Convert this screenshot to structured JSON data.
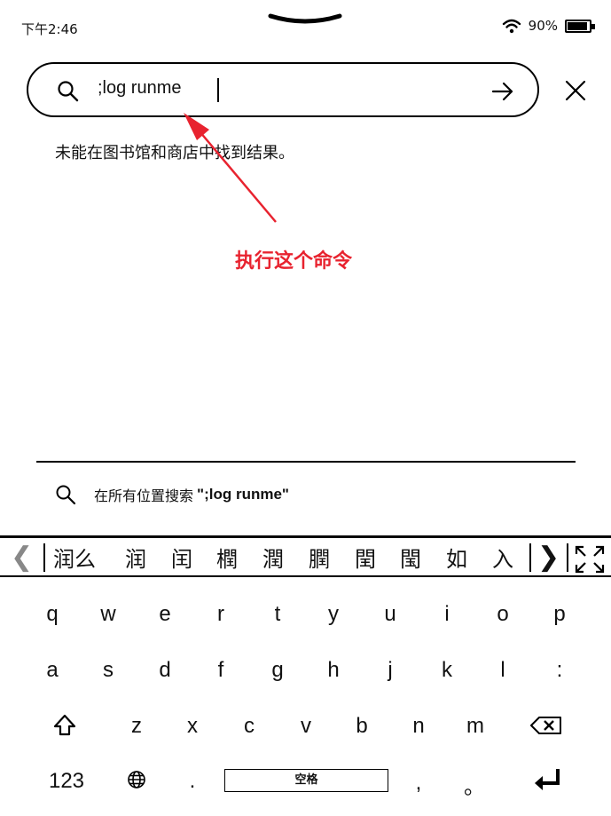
{
  "status_bar": {
    "time": "下午2:46",
    "battery_percent": "90%",
    "battery_level": 0.9,
    "icons": [
      "wifi-icon",
      "battery-icon",
      "pull-down-handle-icon"
    ]
  },
  "search": {
    "query": ";log runme",
    "icons": [
      "search-icon",
      "arrow-right-icon",
      "close-icon"
    ]
  },
  "results": {
    "message": "未能在图书馆和商店中找到结果。",
    "search_everywhere_label": "在所有位置搜索",
    "search_everywhere_query": "\";log runme\""
  },
  "annotation": {
    "text": "执行这个命令",
    "color": "#e8232f"
  },
  "candidates": {
    "prev_icon": "chevron-left-icon",
    "items": [
      "润么",
      "润",
      "闰",
      "橍",
      "潤",
      "膶",
      "閏",
      "閠",
      "如",
      "入"
    ],
    "next_icon": "chevron-right-icon",
    "expand_icon": "expand-icon"
  },
  "keyboard": {
    "row1": [
      "q",
      "w",
      "e",
      "r",
      "t",
      "y",
      "u",
      "i",
      "o",
      "p"
    ],
    "row2": [
      "a",
      "s",
      "d",
      "f",
      "g",
      "h",
      "j",
      "k",
      "l",
      ":"
    ],
    "row3": [
      "z",
      "x",
      "c",
      "v",
      "b",
      "n",
      "m"
    ],
    "row4": {
      "numbers": "123",
      "globe_icon": "globe-icon",
      "period": ".",
      "space": "空格",
      "comma": ",",
      "cjk_period": "。",
      "enter_icon": "enter-icon"
    },
    "shift_icon": "shift-icon",
    "backspace_icon": "backspace-icon"
  }
}
